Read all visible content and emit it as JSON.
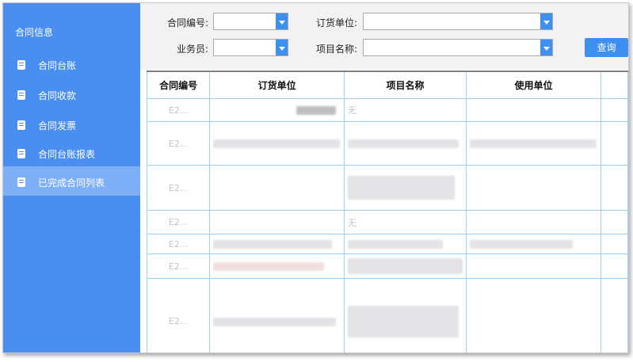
{
  "sidebar": {
    "title": "合同信息",
    "items": [
      {
        "label": "合同台账",
        "icon": "document-icon",
        "active": false
      },
      {
        "label": "合同收款",
        "icon": "document-icon",
        "active": false
      },
      {
        "label": "合同发票",
        "icon": "document-icon",
        "active": false
      },
      {
        "label": "合同台账报表",
        "icon": "document-icon",
        "active": false
      },
      {
        "label": "已完成合同列表",
        "icon": "document-icon",
        "active": true
      }
    ]
  },
  "filters": {
    "contract_no_label": "合同编号:",
    "contract_no_value": "",
    "order_unit_label": "订货单位:",
    "order_unit_value": "",
    "salesperson_label": "业务员:",
    "salesperson_value": "",
    "project_name_label": "项目名称:",
    "project_name_value": "",
    "query_button": "查询"
  },
  "table": {
    "headers": [
      "合同编号",
      "订货单位",
      "项目名称",
      "使用单位"
    ],
    "rows": [
      {
        "no": "E2...",
        "project": "无"
      },
      {
        "no": "E2...",
        "project": ""
      },
      {
        "no": "E2...",
        "project": ""
      },
      {
        "no": "E2...",
        "project": "无"
      },
      {
        "no": "E2...",
        "project": ""
      },
      {
        "no": "E2...",
        "project": ""
      },
      {
        "no": "E2...",
        "project": ""
      }
    ]
  },
  "colors": {
    "sidebar_bg": "#4a8ff0",
    "sidebar_active": "#7eb0f7",
    "accent": "#3d8ff0",
    "grid": "#9ecff5"
  }
}
